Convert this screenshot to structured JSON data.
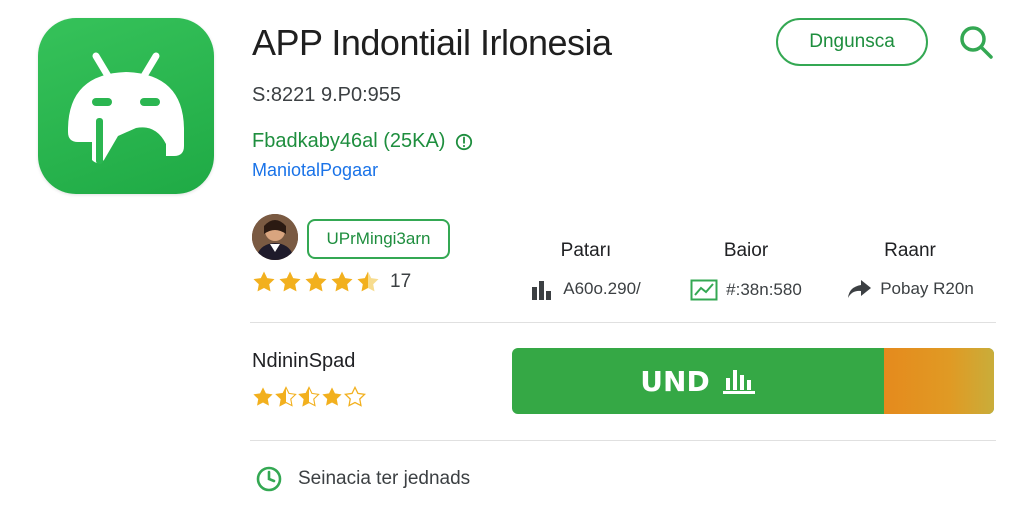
{
  "app": {
    "title": "APP Indontiail Irlonesia",
    "version": "S:8221 9.P0:955",
    "developer": "Fbadkaby46al (25KA)",
    "category": "ManiotalPogaar"
  },
  "header": {
    "install_pill_label": "Dngunsca"
  },
  "reviewer": {
    "badge_label": "UPrMingi3arn",
    "rating_stars": 4.5,
    "rating_count": "17"
  },
  "stats": [
    {
      "label": "Patarı",
      "value": "A60o.290/",
      "icon": "bar-chart-icon"
    },
    {
      "label": "Baior",
      "value": "#:38n:580",
      "icon": "trend-chart-icon"
    },
    {
      "label": "Raanr",
      "value": "Pobay R20n",
      "icon": "share-arrow-icon"
    }
  ],
  "section": {
    "title": "NdininSpad",
    "rating_stars": 3.5
  },
  "action_button": {
    "label": "UND"
  },
  "footer": {
    "text": "Seinacia ter jednads"
  },
  "colors": {
    "brand_green": "#34a853",
    "text_green": "#1e8e3e",
    "link_blue": "#1a73e8",
    "star_gold": "#f2b01e",
    "button_orange": "#e58a1d"
  }
}
